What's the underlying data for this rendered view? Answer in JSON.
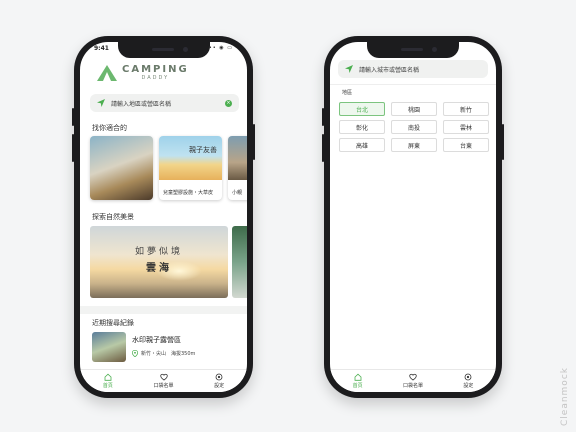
{
  "phone_left": {
    "status": {
      "time": "9:41",
      "indicators": "••• ◉ ▭"
    },
    "logo": {
      "line1": "CAMPING",
      "line2": "DADDY"
    },
    "search": {
      "placeholder": "請輸入地區或營區名稱"
    },
    "section_suited": {
      "title": "找你適合的"
    },
    "cards": [
      {
        "caption": "",
        "image": "tent-by-lake"
      },
      {
        "caption": "兒童塑膠設施・大草皮",
        "tag": "親子友善",
        "image": "kids-playing"
      },
      {
        "caption": "小親",
        "image": "camp-scene"
      }
    ],
    "section_nature": {
      "title": "探索自然美景"
    },
    "banner": {
      "line1": "如夢似境",
      "line2": "雲海"
    },
    "section_recent": {
      "title": "近期搜尋紀錄"
    },
    "recent": {
      "title": "水印親子露營區",
      "meta": "新竹・尖山　海拔350m"
    },
    "tabs": [
      {
        "label": "首頁",
        "icon": "home-icon",
        "active": true
      },
      {
        "label": "口袋名單",
        "icon": "heart-icon",
        "active": false
      },
      {
        "label": "設定",
        "icon": "gear-icon",
        "active": false
      }
    ]
  },
  "phone_right": {
    "search": {
      "placeholder": "請輸入城市或營區名稱"
    },
    "region_label": "地區",
    "regions": [
      "台北",
      "桃園",
      "新竹",
      "彰化",
      "南投",
      "雲林",
      "高雄",
      "屏東",
      "台東"
    ],
    "selected_region": "台北",
    "tabs": [
      {
        "label": "首頁",
        "icon": "home-icon",
        "active": true
      },
      {
        "label": "口袋名單",
        "icon": "heart-icon",
        "active": false
      },
      {
        "label": "設定",
        "icon": "gear-icon",
        "active": false
      }
    ]
  },
  "watermark": "Cleanmock",
  "colors": {
    "accent": "#4caf50",
    "frame": "#1c1c1e",
    "background": "#f4f5f6"
  }
}
